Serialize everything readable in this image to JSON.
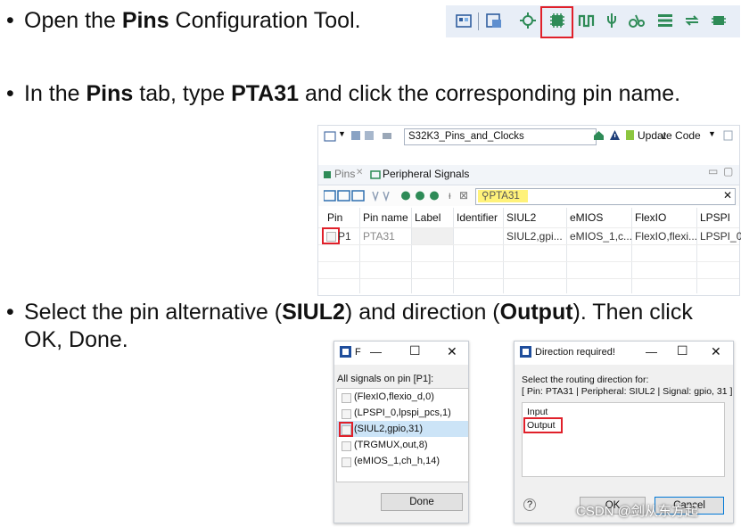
{
  "steps": [
    {
      "bullet": "•",
      "pre": "Open the ",
      "bold": "Pins",
      "post": " Configuration Tool."
    },
    {
      "bullet": "•",
      "pre": "In the ",
      "bold": "Pins",
      "mid": " tab, type ",
      "bold2": "PTA31",
      "post": " and click the corresponding pin name."
    },
    {
      "bullet": "•",
      "pre": "Select the pin alternative (",
      "bold": "SIUL2",
      "mid": ") and direction (",
      "bold2": "Output",
      "post": "). Then click",
      "line2": "OK, Done."
    }
  ],
  "pins_tool": {
    "project_combo": "S32K3_Pins_and_Clocks",
    "update_code_label": "Update Code",
    "tab_pins": "Pins",
    "tab_peripheral": "Peripheral Signals",
    "search_value": "PTA31",
    "columns": [
      "Pin",
      "Pin name",
      "Label",
      "Identifier",
      "SIUL2",
      "eMIOS",
      "FlexIO",
      "LPSPI"
    ],
    "row": {
      "pin": "P1",
      "pin_name": "PTA31",
      "label": "",
      "identifier": "",
      "siul2": "SIUL2,gpi...",
      "emios": "eMIOS_1,c...",
      "flexio": "FlexIO,flexi...",
      "lpspi": "LPSPI_0"
    }
  },
  "signals_dialog": {
    "title_initial": "F",
    "heading": "All signals on pin [P1]:",
    "signals": [
      "(FlexIO,flexio_d,0)",
      "(LPSPI_0,lpspi_pcs,1)",
      "(SIUL2,gpio,31)",
      "(TRGMUX,out,8)",
      "(eMIOS_1,ch_h,14)"
    ],
    "done_label": "Done"
  },
  "direction_dialog": {
    "title": "Direction required!",
    "prompt": "Select the routing direction for:",
    "detail": "[ Pin: PTA31 | Peripheral: SIUL2 | Signal: gpio, 31 ]",
    "options": [
      "Input",
      "Output"
    ],
    "ok_label": "OK",
    "cancel_label": "Cancel"
  },
  "watermark": "CSDN @剑从东方起",
  "colors": {
    "highlight_red": "#e0202a",
    "selected_row": "#cce4f7",
    "toolbar_bg": "#e8eef7"
  }
}
